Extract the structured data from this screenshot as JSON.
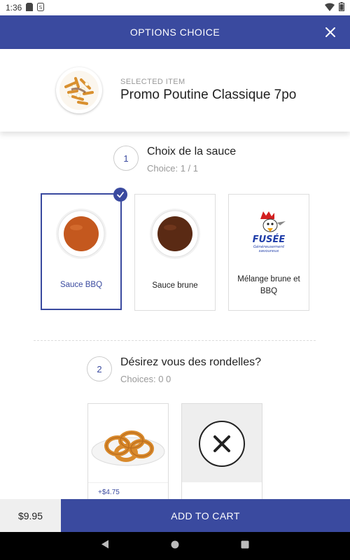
{
  "status_bar": {
    "time": "1:36",
    "icons": [
      "sd-card-icon",
      "sim-icon",
      "wifi-icon",
      "battery-icon"
    ]
  },
  "header": {
    "title": "OPTIONS CHOICE",
    "close_icon": "close-icon"
  },
  "selected_item": {
    "caption": "SELECTED ITEM",
    "name": "Promo Poutine Classique 7po"
  },
  "steps": [
    {
      "number": "1",
      "title": "Choix de la sauce",
      "subtitle": "Choice: 1 / 1",
      "options": [
        {
          "label": "Sauce BBQ",
          "selected": true
        },
        {
          "label": "Sauce brune",
          "selected": false
        },
        {
          "label": "Mélange brune et BBQ",
          "selected": false
        }
      ]
    },
    {
      "number": "2",
      "title": "Désirez vous des rondelles?",
      "subtitle": "Choices: 0 0",
      "options": [
        {
          "label": "",
          "price": "+$4.75",
          "selected": false
        },
        {
          "label": "",
          "selected": false
        }
      ]
    }
  ],
  "logo": {
    "brand": "FUSÉE",
    "tagline_line1": "Généreusement",
    "tagline_line2": "savoureux"
  },
  "footer": {
    "price": "$9.95",
    "add_to_cart": "ADD TO CART"
  },
  "colors": {
    "accent": "#3a4a9f",
    "bbq_sauce": "#c4581e",
    "brown_sauce": "#5a2a14"
  }
}
